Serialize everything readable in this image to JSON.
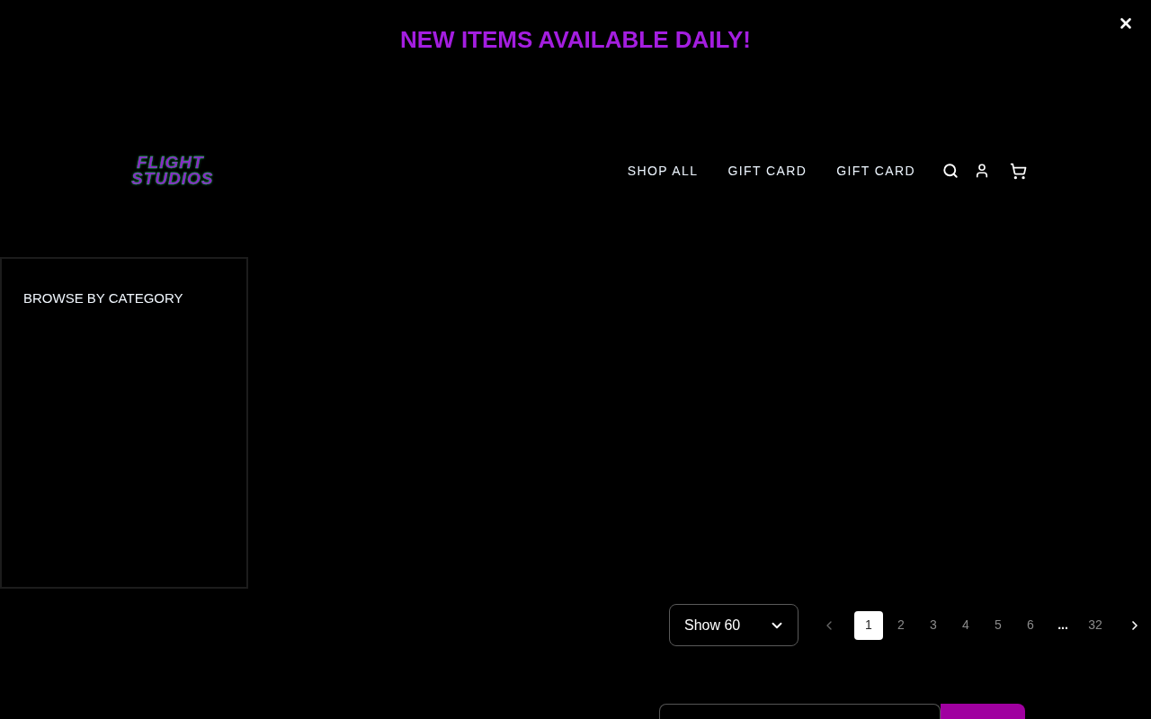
{
  "announcement": {
    "text": "NEW ITEMS AVAILABLE DAILY!"
  },
  "logo": {
    "lines": [
      "FLIGHT",
      "STUDIOS"
    ]
  },
  "nav": {
    "links": [
      "SHOP ALL",
      "GIFT CARD",
      "GIFT CARD"
    ]
  },
  "sidebar": {
    "title": "BROWSE BY CATEGORY"
  },
  "page_size": {
    "value": "Show 60"
  },
  "pagination": {
    "prev": {
      "disabled": true
    },
    "pages": [
      {
        "kind": "page",
        "label": "1",
        "selected": true
      },
      {
        "kind": "page",
        "label": "2",
        "selected": false
      },
      {
        "kind": "page",
        "label": "3",
        "selected": false
      },
      {
        "kind": "page",
        "label": "4",
        "selected": false
      },
      {
        "kind": "page",
        "label": "5",
        "selected": false
      },
      {
        "kind": "page",
        "label": "6",
        "selected": false
      },
      {
        "kind": "ellipsis",
        "label": "...",
        "selected": false
      },
      {
        "kind": "page",
        "label": "32",
        "selected": false
      }
    ],
    "next": {
      "disabled": false
    }
  }
}
